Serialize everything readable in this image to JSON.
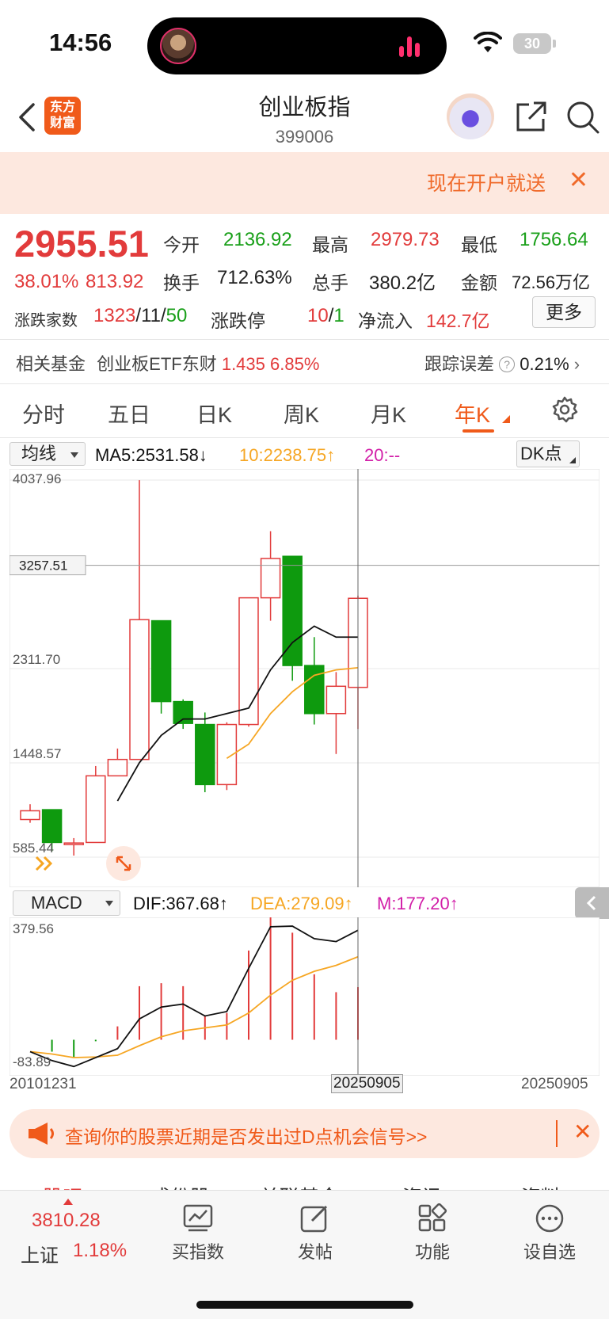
{
  "status_bar": {
    "time": "14:56",
    "battery": "30"
  },
  "header": {
    "title": "创业板指",
    "code": "399006",
    "logo_line1": "东方",
    "logo_line2": "财富"
  },
  "promo": {
    "text": "现在开户就送",
    "close": "✕"
  },
  "quote": {
    "price": "2955.51",
    "change_pct": "38.01%",
    "change_abs": "813.92",
    "open_label": "今开",
    "open": "2136.92",
    "high_label": "最高",
    "high": "2979.73",
    "low_label": "最低",
    "low": "1756.64",
    "turnover_label": "换手",
    "turnover": "712.63%",
    "volume_label": "总手",
    "volume": "380.2亿",
    "amount_label": "金额",
    "amount": "72.56万亿",
    "breadth_label": "涨跌家数",
    "breadth_up": "1323",
    "breadth_flat": "11",
    "breadth_down": "50",
    "limit_label": "涨跌停",
    "limit_up": "10",
    "limit_down": "1",
    "inflow_label": "净流入",
    "inflow": "142.7亿",
    "more": "更多"
  },
  "fund": {
    "label": "相关基金",
    "name": "创业板ETF东财",
    "price": "1.435",
    "pct": "6.85%",
    "error_label": "跟踪误差",
    "error_value": "0.21%"
  },
  "tabs": [
    "分时",
    "五日",
    "日K",
    "周K",
    "月K",
    "年K"
  ],
  "active_tab": "年K",
  "ma_row": {
    "selector": "均线",
    "ma5": "MA5:2531.58",
    "ma10": "10:2238.75",
    "ma20": "20:--",
    "dk": "DK点"
  },
  "macd_row": {
    "selector": "MACD",
    "dif": "DIF:367.68",
    "dea": "DEA:279.09",
    "m": "M:177.20"
  },
  "colors": {
    "up": "#e23b3b",
    "down": "#0e9a0e",
    "ma5": "#111111",
    "ma10": "#f6a623",
    "ma20": "#d21ea8",
    "accent": "#f05a1a"
  },
  "chart_data": [
    {
      "type": "candlestick",
      "ylim": [
        585.44,
        4037.96
      ],
      "y_labels": [
        "4037.96",
        "2311.70",
        "1448.57",
        "585.44"
      ],
      "crosshair_price": "3257.51",
      "series": [
        {
          "x": "2010",
          "open": 930,
          "close": 1010,
          "high": 1070,
          "low": 900
        },
        {
          "x": "2011",
          "open": 1020,
          "close": 720,
          "high": 1020,
          "low": 640
        },
        {
          "x": "2012",
          "open": 710,
          "close": 715,
          "high": 760,
          "low": 600
        },
        {
          "x": "2013",
          "open": 720,
          "close": 1330,
          "high": 1420,
          "low": 720
        },
        {
          "x": "2014",
          "open": 1330,
          "close": 1480,
          "high": 1580,
          "low": 1330
        },
        {
          "x": "2015",
          "open": 1480,
          "close": 2760,
          "high": 4037,
          "low": 1480
        },
        {
          "x": "2016",
          "open": 2750,
          "close": 2010,
          "high": 2750,
          "low": 1900
        },
        {
          "x": "2017",
          "open": 2010,
          "close": 1810,
          "high": 2030,
          "low": 1760
        },
        {
          "x": "2018",
          "open": 1800,
          "close": 1250,
          "high": 1910,
          "low": 1180
        },
        {
          "x": "2019",
          "open": 1250,
          "close": 1800,
          "high": 1820,
          "low": 1200
        },
        {
          "x": "2020",
          "open": 1800,
          "close": 2960,
          "high": 2960,
          "low": 1780
        },
        {
          "x": "2021",
          "open": 2960,
          "close": 3320,
          "high": 3570,
          "low": 2750
        },
        {
          "x": "2022",
          "open": 3340,
          "close": 2340,
          "high": 3340,
          "low": 2200
        },
        {
          "x": "2023",
          "open": 2340,
          "close": 1900,
          "high": 2600,
          "low": 1800
        },
        {
          "x": "2024",
          "open": 1900,
          "close": 2150,
          "high": 2280,
          "low": 1530
        },
        {
          "x": "2025",
          "open": 2140,
          "close": 2955.51,
          "high": 2980,
          "low": 1760
        }
      ],
      "ma5": [
        null,
        null,
        null,
        null,
        1100,
        1450,
        1700,
        1850,
        1850,
        1900,
        1950,
        2300,
        2550,
        2700,
        2600,
        2600
      ],
      "ma10": [
        null,
        null,
        null,
        null,
        null,
        null,
        null,
        null,
        null,
        1490,
        1620,
        1900,
        2100,
        2250,
        2300,
        2320
      ]
    },
    {
      "type": "macd",
      "ylim": [
        -83.89,
        379.56
      ],
      "y_labels": [
        "379.56",
        "-83.89"
      ],
      "x_labels": [
        "20101231",
        "20250905",
        "20250905"
      ],
      "dif": [
        -40,
        -70,
        -90,
        -60,
        -30,
        70,
        110,
        120,
        80,
        95,
        240,
        380,
        382,
        340,
        330,
        368
      ],
      "dea": [
        -40,
        -48,
        -60,
        -58,
        -52,
        -20,
        10,
        30,
        40,
        50,
        90,
        150,
        200,
        230,
        250,
        279
      ],
      "m": [
        0,
        -40,
        -60,
        -5,
        45,
        180,
        190,
        180,
        80,
        90,
        300,
        450,
        360,
        220,
        160,
        177
      ]
    }
  ],
  "bottom_promo": {
    "text": "查询你的股票近期是否发出过D点机会信号>>",
    "close": "✕"
  },
  "partial_tabs": [
    "股吧",
    "成份股",
    "关联基金",
    "资讯",
    "资料"
  ],
  "bottom_nav": {
    "index_value": "3810.28",
    "index_name": "上证",
    "index_pct": "1.18%",
    "items": [
      "买指数",
      "发帖",
      "功能",
      "设自选"
    ]
  }
}
